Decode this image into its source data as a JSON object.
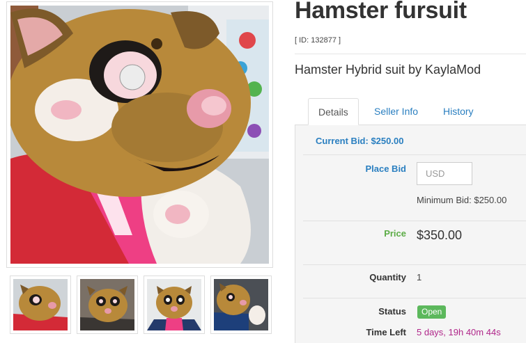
{
  "listing": {
    "title": "Hamster fursuit",
    "id_text": "[ ID: 132877 ]",
    "subtitle": "Hamster Hybrid suit by KaylaMod"
  },
  "gallery": {
    "main_photo": "fursuit-head-photo",
    "thumbnails": [
      "fursuit-photo-1",
      "fursuit-photo-2",
      "fursuit-photo-3",
      "fursuit-photo-4"
    ]
  },
  "tabs": [
    {
      "label": "Details",
      "active": true
    },
    {
      "label": "Seller Info",
      "active": false
    },
    {
      "label": "History",
      "active": false
    }
  ],
  "details": {
    "current_bid": "Current Bid: $250.00",
    "place_bid_label": "Place Bid",
    "bid_placeholder": "USD",
    "minimum_bid": "Minimum Bid: $250.00",
    "price_label": "Price",
    "price_value": "$350.00",
    "quantity_label": "Quantity",
    "quantity_value": "1",
    "status_label": "Status",
    "status_value": "Open",
    "time_left_label": "Time Left",
    "time_left_value": "5 days, 19h 40m 44s"
  },
  "colors": {
    "link_blue": "#2a7fc0",
    "price_green": "#5cac46",
    "status_green": "#5cb85c",
    "time_magenta": "#b0278a"
  }
}
